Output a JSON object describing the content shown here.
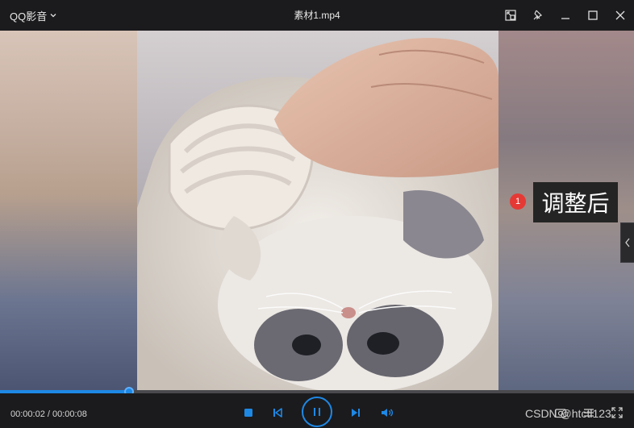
{
  "app": {
    "menu_label": "QQ影音"
  },
  "window": {
    "title": "素材1.mp4"
  },
  "annotation": {
    "badge": "1",
    "text": "调整后"
  },
  "playback": {
    "current_time": "00:00:02",
    "separator": " / ",
    "total_time": "00:00:08",
    "progress_fraction": 0.204
  },
  "watermark": "CSDN @htctl123",
  "colors": {
    "accent": "#1e88e5",
    "badge": "#e53935",
    "background": "#1b1b1d"
  },
  "icons": {
    "titlebar": [
      "mini-mode-icon",
      "pin-icon",
      "minimize-icon",
      "maximize-icon",
      "close-icon"
    ],
    "controls": [
      "stop-icon",
      "previous-icon",
      "pause-icon",
      "next-icon",
      "volume-icon",
      "screenshot-icon",
      "playlist-icon",
      "fullscreen-icon"
    ]
  }
}
